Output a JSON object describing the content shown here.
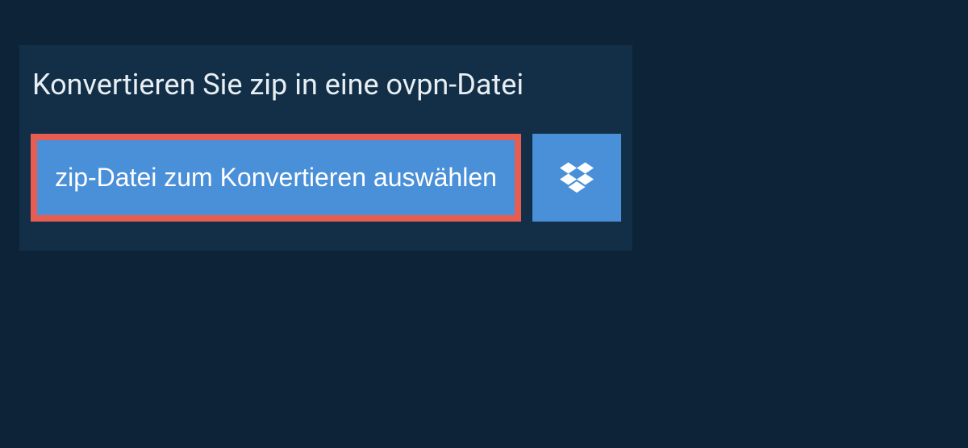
{
  "panel": {
    "heading": "Konvertieren Sie zip in eine ovpn-Datei",
    "choose_file_label": "zip-Datei zum Konvertieren auswählen"
  },
  "colors": {
    "background": "#0d2438",
    "panel": "#122f47",
    "button": "#4a90d9",
    "highlight_border": "#e85d52"
  }
}
